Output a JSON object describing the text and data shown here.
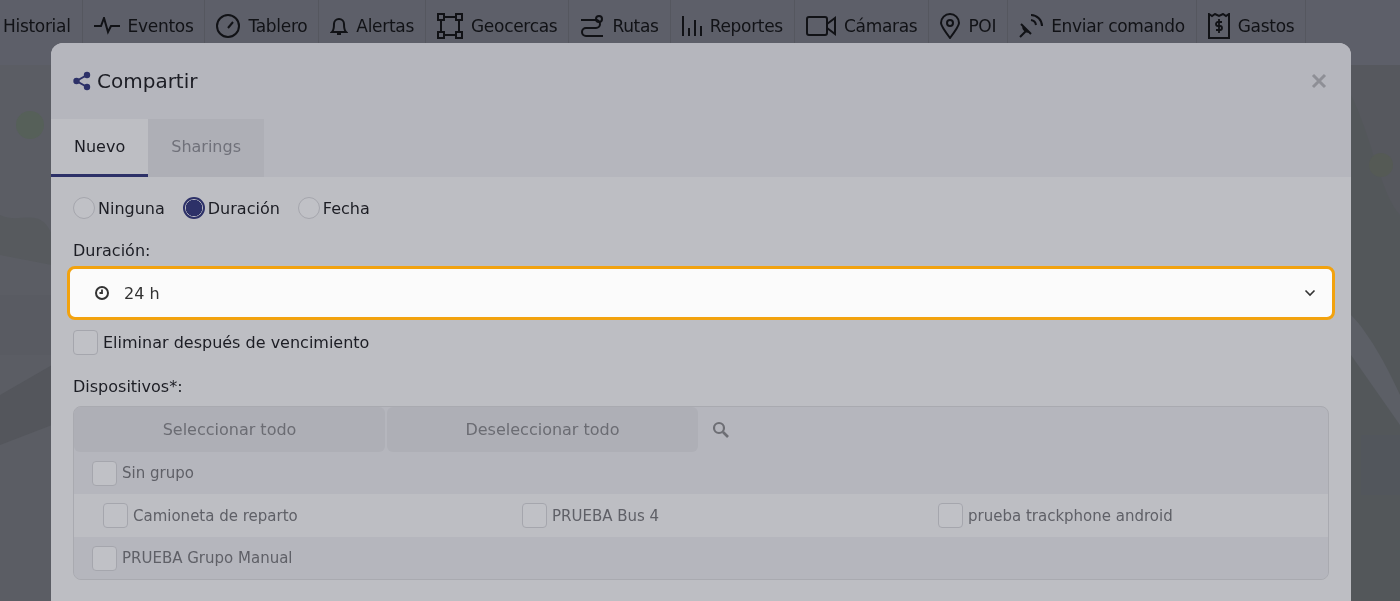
{
  "nav": [
    {
      "label": "Historial"
    },
    {
      "label": "Eventos"
    },
    {
      "label": "Tablero"
    },
    {
      "label": "Alertas"
    },
    {
      "label": "Geocercas"
    },
    {
      "label": "Rutas"
    },
    {
      "label": "Reportes"
    },
    {
      "label": "Cámaras"
    },
    {
      "label": "POI"
    },
    {
      "label": "Enviar comando"
    },
    {
      "label": "Gastos"
    }
  ],
  "dialog": {
    "title": "Compartir",
    "tabs": [
      {
        "label": "Nuevo",
        "selected": true
      },
      {
        "label": "Sharings",
        "selected": false
      }
    ],
    "expiry_options": [
      {
        "label": "Ninguna",
        "selected": false
      },
      {
        "label": "Duración",
        "selected": true
      },
      {
        "label": "Fecha",
        "selected": false
      }
    ],
    "duration_label": "Duración:",
    "duration_value": "24 h",
    "delete_after": {
      "label": "Eliminar después de vencimiento",
      "checked": false
    },
    "devices_label": "Dispositivos*:",
    "select_all": "Seleccionar todo",
    "deselect_all": "Deseleccionar todo",
    "groups": [
      {
        "name": "Sin grupo",
        "checked": false,
        "devices": [
          {
            "name": "Camioneta de reparto",
            "checked": false
          },
          {
            "name": "PRUEBA Bus 4",
            "checked": false
          },
          {
            "name": "prueba trackphone android",
            "checked": false
          }
        ]
      },
      {
        "name": "PRUEBA Grupo Manual",
        "checked": false
      }
    ]
  }
}
